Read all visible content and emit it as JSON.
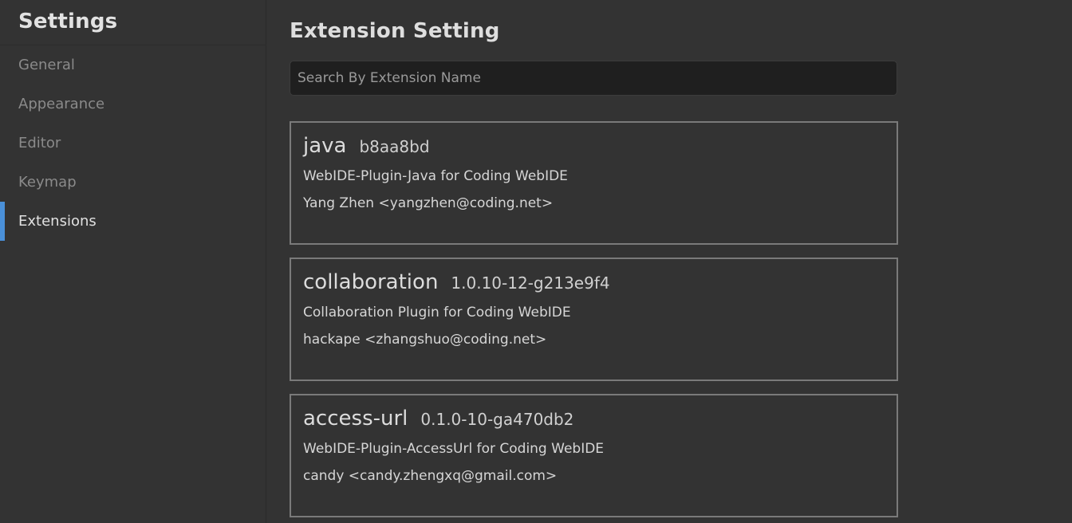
{
  "sidebar": {
    "title": "Settings",
    "items": [
      {
        "label": "General",
        "active": false
      },
      {
        "label": "Appearance",
        "active": false
      },
      {
        "label": "Editor",
        "active": false
      },
      {
        "label": "Keymap",
        "active": false
      },
      {
        "label": "Extensions",
        "active": true
      }
    ]
  },
  "main": {
    "title": "Extension Setting",
    "search": {
      "value": "",
      "placeholder": "Search By Extension Name"
    },
    "extensions": [
      {
        "name": "java",
        "version": "b8aa8bd",
        "description": "WebIDE-Plugin-Java for Coding WebIDE",
        "author": "Yang Zhen <yangzhen@coding.net>"
      },
      {
        "name": "collaboration",
        "version": "1.0.10-12-g213e9f4",
        "description": "Collaboration Plugin for Coding WebIDE",
        "author": "hackape <zhangshuo@coding.net>"
      },
      {
        "name": "access-url",
        "version": "0.1.0-10-ga470db2",
        "description": "WebIDE-Plugin-AccessUrl for Coding WebIDE",
        "author": "candy <candy.zhengxq@gmail.com>"
      }
    ]
  },
  "colors": {
    "background": "#333333",
    "active_indicator": "#4a90d9",
    "search_background": "#1f1f1f",
    "card_border": "#7a7a7a"
  }
}
